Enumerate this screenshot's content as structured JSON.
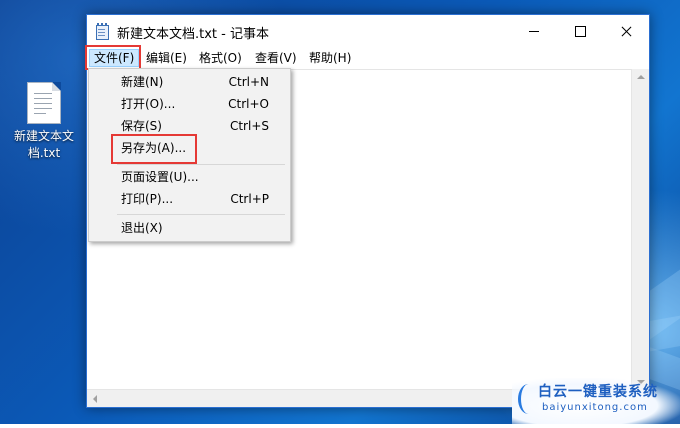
{
  "desktop": {
    "icon_label_line1": "新建文本文",
    "icon_label_line2": "档.txt"
  },
  "window": {
    "title": "新建文本文档.txt - 记事本",
    "controls": {
      "minimize": "minimize-icon",
      "maximize": "maximize-icon",
      "close": "close-icon"
    }
  },
  "menubar": {
    "file": "文件(F)",
    "edit": "编辑(E)",
    "format": "格式(O)",
    "view": "查看(V)",
    "help": "帮助(H)"
  },
  "file_menu": {
    "new": {
      "label": "新建(N)",
      "shortcut": "Ctrl+N"
    },
    "open": {
      "label": "打开(O)...",
      "shortcut": "Ctrl+O"
    },
    "save": {
      "label": "保存(S)",
      "shortcut": "Ctrl+S"
    },
    "save_as": {
      "label": "另存为(A)..."
    },
    "page_setup": {
      "label": "页面设置(U)..."
    },
    "print": {
      "label": "打印(P)...",
      "shortcut": "Ctrl+P"
    },
    "exit": {
      "label": "退出(X)"
    }
  },
  "watermark": {
    "title": "白云一键重装系统",
    "url": "baiyunxitong.com"
  },
  "colors": {
    "highlight_box": "#e53935",
    "menu_active_bg": "#cce8ff",
    "window_border": "#2b6fd1"
  }
}
